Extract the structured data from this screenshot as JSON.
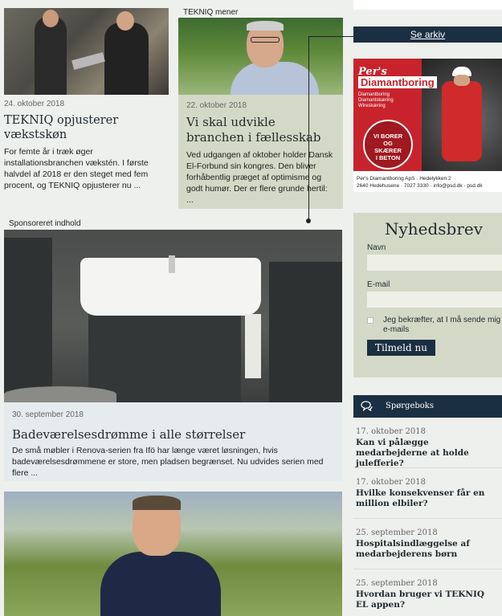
{
  "articles": {
    "a1": {
      "date": "24. oktober 2018",
      "title": "TEKNIQ opjusterer vækstskøn",
      "excerpt": "For femte år i træk øger installationsbranchen vækstén. I første halvdel af 2018 er den steget med fem procent, og TEKNIQ opjusterer nu ..."
    },
    "mener": {
      "kicker": "TEKNIQ mener",
      "date": "22. oktober 2018",
      "title": "Vi skal udvikle branchen i fællesskab",
      "excerpt": "Ved udgangen af oktober holder Dansk El-Forbund sin kongres. Den bliver forhåbentlig præget af optimisme og godt humør. Der er flere grunde hertil: ..."
    },
    "sponsored": {
      "kicker": "Sponsoreret indhold",
      "date": "30. september 2018",
      "title": "Badeværelsesdrømme i alle størrelser",
      "excerpt": "De små møbler i Renova-serien fra Ifö har længe været løsningen, hvis badeværelsesdrømmene er store, men pladsen begrænset. Nu udvides serien med flere ..."
    }
  },
  "sidebar": {
    "archive_label": "Se arkiv",
    "ad": {
      "brand_line1": "Per's",
      "brand_line2": "Diamantboring",
      "services": [
        "Diamantboring",
        "Diamantskæring",
        "Wireskæring"
      ],
      "seal": [
        "VI BORER",
        "OG",
        "SKÆRER",
        "I BETON"
      ],
      "footer_line1": "Per's Diamantboring ApS · Hedelykken 2",
      "footer_line2": "2640 Hedehusene · 7027 3330 · info@psd.dk · psd.dk"
    },
    "newsletter": {
      "heading": "Nyhedsbrev",
      "name_label": "Navn",
      "email_label": "E-mail",
      "consent": "Jeg bekræfter, at I må sende mig e-mails",
      "submit": "Tilmeld nu"
    },
    "qa": {
      "heading": "Spørgeboks",
      "items": [
        {
          "date": "17. oktober 2018",
          "title": "Kan vi pålægge medarbejderne at holde julefferie?"
        },
        {
          "date": "17. oktober 2018",
          "title": "Hvilke konsekvenser får en million elbiler?"
        },
        {
          "date": "25. september 2018",
          "title": "Hospitalsindlæggelse af medarbejderens børn"
        },
        {
          "date": "25. september 2018",
          "title": "Hvordan bruger vi TEKNIQ EL appen?"
        }
      ]
    }
  },
  "colors": {
    "navy": "#1b2f42",
    "sage": "#d4d9c7",
    "ad_red": "#c8232c"
  }
}
